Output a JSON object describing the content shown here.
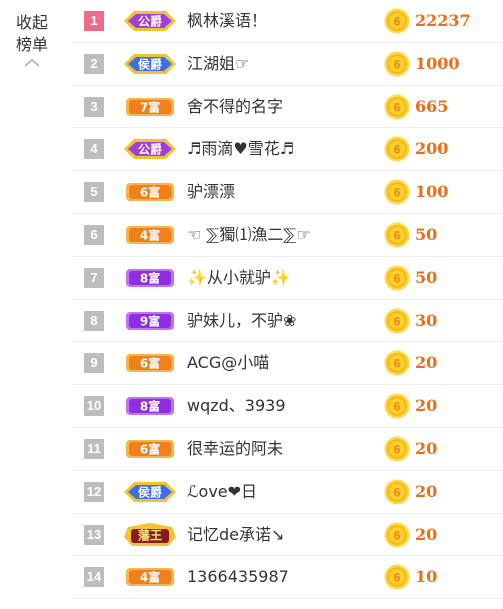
{
  "collapse": {
    "label": "收起\n榜单"
  },
  "colors": {
    "rank_top": "#f06a8a",
    "rank_default": "#bdbdbd",
    "amount": "#ef6b14",
    "coin": "#f7c71c"
  },
  "coin_text": "6",
  "rows": [
    {
      "rank": "1",
      "badge_text": "公爵",
      "badge_type": "duke",
      "name": "枫林溪语！",
      "amount": "22237"
    },
    {
      "rank": "2",
      "badge_text": "侯爵",
      "badge_type": "marquis",
      "name": "江湖姐☞",
      "amount": "1000"
    },
    {
      "rank": "3",
      "badge_text": "7富",
      "badge_type": "rich-orange",
      "name": "舍不得的名字",
      "amount": "665"
    },
    {
      "rank": "4",
      "badge_text": "公爵",
      "badge_type": "duke",
      "name": "♬雨滴♥雪花♬",
      "amount": "200"
    },
    {
      "rank": "5",
      "badge_text": "6富",
      "badge_type": "rich-orange",
      "name": "驴漂漂",
      "amount": "100"
    },
    {
      "rank": "6",
      "badge_text": "4富",
      "badge_type": "rich-orange",
      "name": "☜ ⅀獨⑴漁二⅀☞",
      "amount": "50"
    },
    {
      "rank": "7",
      "badge_text": "8富",
      "badge_type": "rich-purple",
      "name": "✨从小就驴✨",
      "amount": "50"
    },
    {
      "rank": "8",
      "badge_text": "9富",
      "badge_type": "rich-purple",
      "name": "驴妹儿，不驴❀",
      "amount": "30"
    },
    {
      "rank": "9",
      "badge_text": "6富",
      "badge_type": "rich-orange",
      "name": "ACG@小喵",
      "amount": "20"
    },
    {
      "rank": "10",
      "badge_text": "8富",
      "badge_type": "rich-purple",
      "name": "wqzd、3939",
      "amount": "20"
    },
    {
      "rank": "11",
      "badge_text": "6富",
      "badge_type": "rich-orange",
      "name": "很幸运的阿未",
      "amount": "20"
    },
    {
      "rank": "12",
      "badge_text": "侯爵",
      "badge_type": "marquis",
      "name": "ℒove❤日",
      "amount": "20"
    },
    {
      "rank": "13",
      "badge_text": "藩王",
      "badge_type": "prince",
      "name": "记忆de承诺↘",
      "amount": "20"
    },
    {
      "rank": "14",
      "badge_text": "4富",
      "badge_type": "rich-orange",
      "name": "1366435987",
      "amount": "10"
    }
  ]
}
